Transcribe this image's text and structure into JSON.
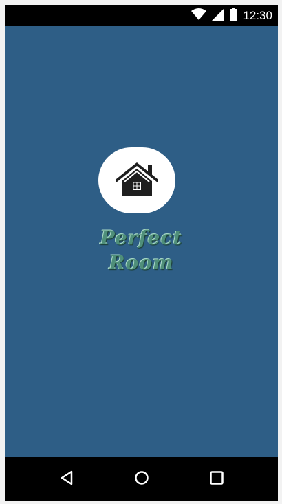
{
  "status_bar": {
    "time": "12:30",
    "icons": [
      "wifi-icon",
      "cellular-signal-icon",
      "battery-icon"
    ]
  },
  "app": {
    "background_color": "#2e5e86",
    "logo_icon": "house-icon",
    "title_line1": "Perfect",
    "title_line2": "Room",
    "title_color": "#4f8f7a"
  },
  "nav_bar": {
    "buttons": [
      "back-icon",
      "home-icon",
      "recents-icon"
    ]
  }
}
